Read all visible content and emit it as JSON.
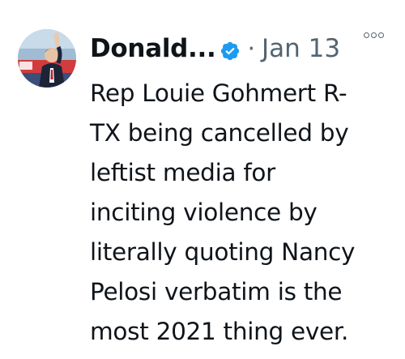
{
  "tweet": {
    "author_name": "Donald...",
    "separator": "·",
    "date": "Jan 13",
    "text": "Rep Louie Gohmert R-\nTX being cancelled by\nleftist media for\ninciting violence by\nliterally quoting Nancy\nPelosi verbatim is the\nmost 2021 thing ever."
  },
  "icons": {
    "verified": "verified-badge-icon",
    "more": "more-options-icon"
  },
  "colors": {
    "text_primary": "#0f1419",
    "text_secondary": "#536471",
    "verified_blue": "#1d9bf0",
    "background": "#ffffff"
  }
}
